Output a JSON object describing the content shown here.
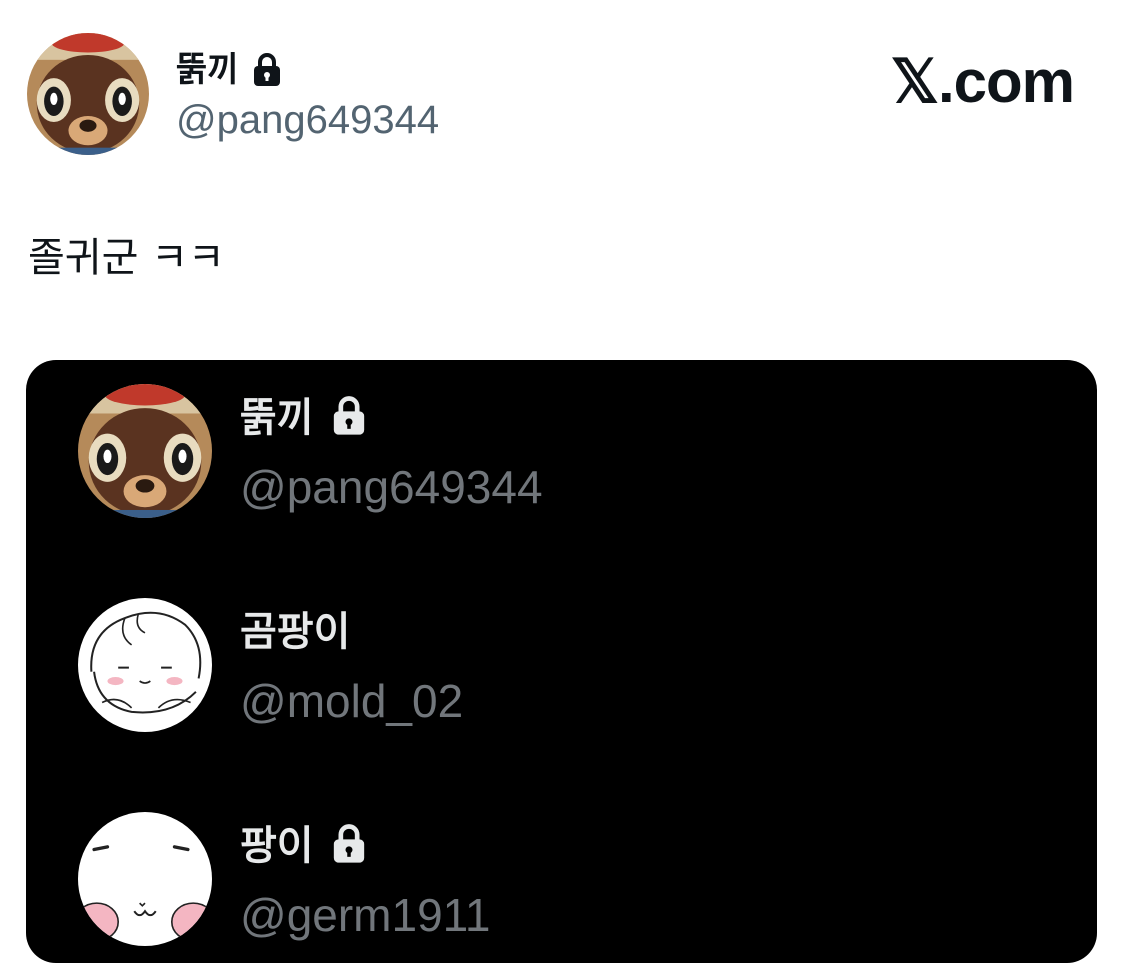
{
  "author": {
    "name": "뚥끼",
    "handle": "@pang649344",
    "protected": true,
    "avatar": "raccoon-character-avatar"
  },
  "brand": "𝕏.com",
  "tweet": {
    "text": "졸귀군 ㅋㅋ"
  },
  "media": {
    "accounts": [
      {
        "name": "뚥끼",
        "handle": "@pang649344",
        "protected": true,
        "avatar": "raccoon-character-avatar"
      },
      {
        "name": "곰팡이",
        "handle": "@mold_02",
        "protected": false,
        "avatar": "white-puppy-doodle-avatar"
      },
      {
        "name": "팡이",
        "handle": "@germ1911",
        "protected": true,
        "avatar": "white-round-face-avatar"
      }
    ]
  },
  "colors": {
    "text_primary": "#0f1419",
    "text_secondary": "#536471",
    "card_bg": "#000000",
    "card_name": "#e7e9ea",
    "card_handle": "#71767b"
  }
}
